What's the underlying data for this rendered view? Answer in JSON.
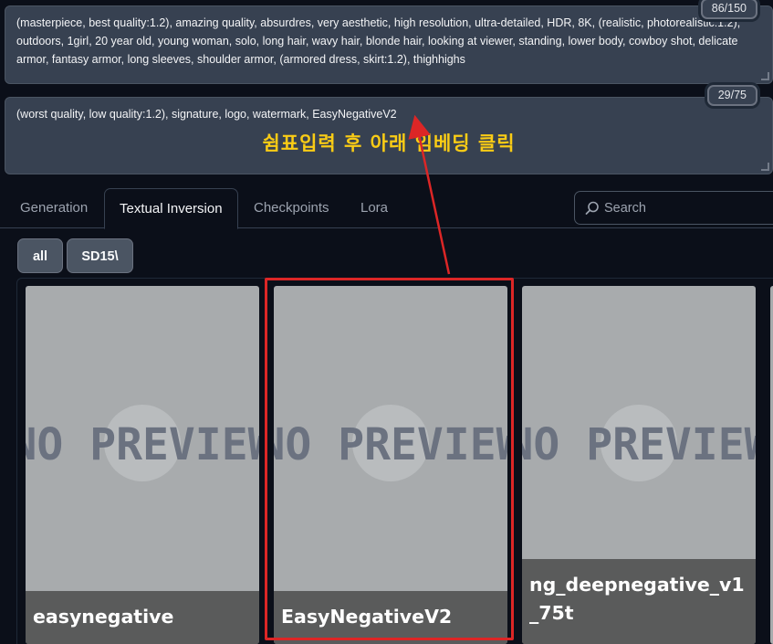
{
  "positive_prompt": {
    "text": "(masterpiece, best quality:1.2), amazing quality, absurdres, very aesthetic, high resolution, ultra-detailed, HDR, 8K, (realistic, photorealistic:1.2), outdoors, 1girl, 20 year old, young woman, solo, long hair, wavy hair, blonde hair, looking at viewer, standing, lower body, cowboy shot, delicate armor, fantasy armor, long sleeves, shoulder armor, (armored dress, skirt:1.2), thighhighs",
    "token_count": "86/150"
  },
  "negative_prompt": {
    "text": "(worst quality, low quality:1.2), signature, logo, watermark, EasyNegativeV2",
    "token_count": "29/75"
  },
  "annotation_text": "쉼표입력 후 아래 임베딩 클릭",
  "tabs": [
    "Generation",
    "Textual Inversion",
    "Checkpoints",
    "Lora"
  ],
  "active_tab": "Textual Inversion",
  "search": {
    "placeholder": "Search",
    "icon": "search-icon"
  },
  "filters": [
    "all",
    "SD15\\"
  ],
  "cards": [
    {
      "label": "easynegative",
      "preview": "NO PREVIEW"
    },
    {
      "label": "EasyNegativeV2",
      "preview": "NO PREVIEW"
    },
    {
      "label": "ng_deepnegative_v1_75t",
      "preview": "NO PREVIEW"
    }
  ],
  "colors": {
    "background": "#0b0f19",
    "prompt_bg": "#374151",
    "annotation": "#facc15",
    "highlight": "#dc2626",
    "card_bg": "#a8abad"
  }
}
